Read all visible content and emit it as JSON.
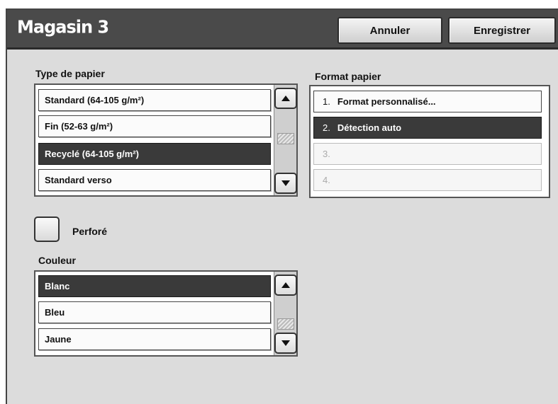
{
  "header": {
    "title": "Magasin 3",
    "cancel_label": "Annuler",
    "save_label": "Enregistrer"
  },
  "paper_type": {
    "label": "Type de papier",
    "items": [
      {
        "label": "Standard (64-105 g/m²)",
        "selected": false
      },
      {
        "label": "Fin (52-63 g/m²)",
        "selected": false
      },
      {
        "label": "Recyclé (64-105 g/m²)",
        "selected": true
      },
      {
        "label": "Standard verso",
        "selected": false
      }
    ]
  },
  "paper_format": {
    "label": "Format papier",
    "items": [
      {
        "number": "1.",
        "label": "Format personnalisé...",
        "selected": false,
        "enabled": true
      },
      {
        "number": "2.",
        "label": "Détection auto",
        "selected": true,
        "enabled": true
      },
      {
        "number": "3.",
        "label": "",
        "selected": false,
        "enabled": false
      },
      {
        "number": "4.",
        "label": "",
        "selected": false,
        "enabled": false
      }
    ]
  },
  "punched": {
    "label": "Perforé",
    "checked": false
  },
  "color": {
    "label": "Couleur",
    "items": [
      {
        "label": "Blanc",
        "selected": true
      },
      {
        "label": "Bleu",
        "selected": false
      },
      {
        "label": "Jaune",
        "selected": false
      }
    ]
  },
  "icons": {
    "scroll_up": "up-arrow-icon",
    "scroll_down": "down-arrow-icon"
  }
}
